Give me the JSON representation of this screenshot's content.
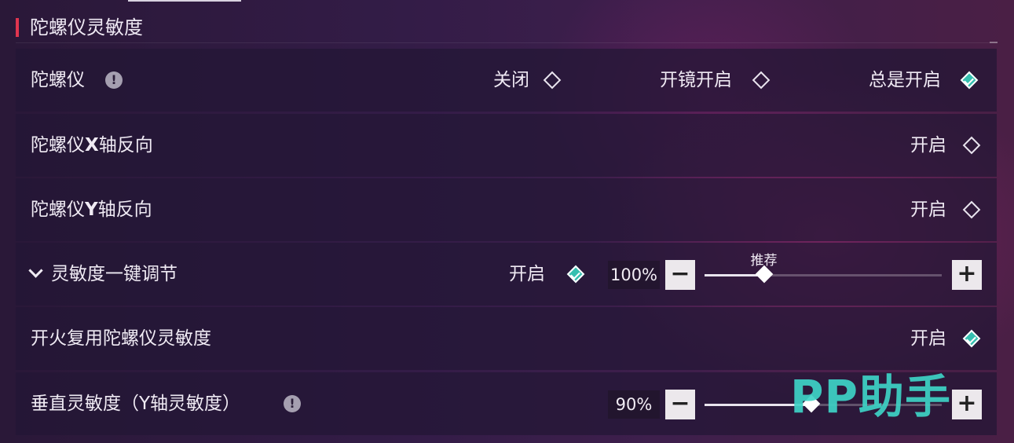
{
  "section": {
    "title": "陀螺仪灵敏度"
  },
  "rows": {
    "gyro": {
      "label": "陀螺仪",
      "info": "!",
      "options": [
        "关闭",
        "开镜开启",
        "总是开启"
      ],
      "selected": "总是开启"
    },
    "invert_x": {
      "label_prefix": "陀螺仪",
      "label_axis": "X",
      "label_suffix": "轴反向",
      "option": "开启",
      "checked": false
    },
    "invert_y": {
      "label_prefix": "陀螺仪",
      "label_axis": "Y",
      "label_suffix": "轴反向",
      "option": "开启",
      "checked": false
    },
    "quick_adjust": {
      "label": "灵敏度一键调节",
      "option": "开启",
      "checked": true,
      "value_text": "100%",
      "value": 100,
      "slider_fraction": 0.25,
      "recommend_label": "推荐",
      "minus": "−",
      "plus": "+"
    },
    "fire_reuse": {
      "label": "开火复用陀螺仪灵敏度",
      "option": "开启",
      "checked": true
    },
    "vertical": {
      "label": "垂直灵敏度（Y轴灵敏度）",
      "info": "!",
      "value_text": "90%",
      "value": 90,
      "slider_fraction": 0.45,
      "minus": "−",
      "plus": "+"
    }
  },
  "watermark": "PP助手",
  "colors": {
    "accent": "#35bfb0",
    "section_bar": "#e0354f",
    "watermark": "#3ed3c6"
  }
}
